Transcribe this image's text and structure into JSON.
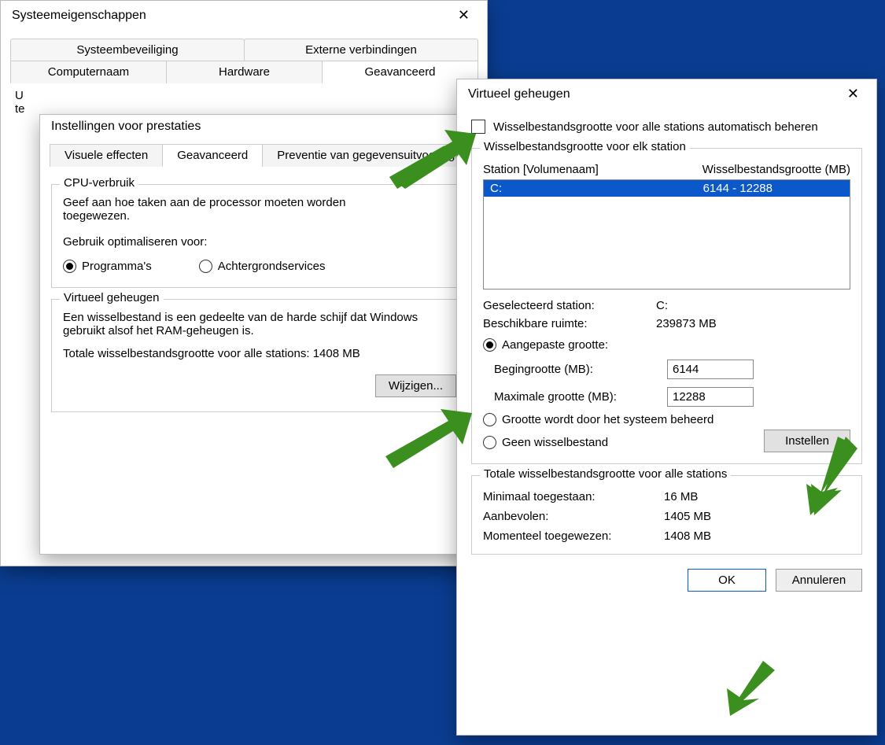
{
  "sys": {
    "title": "Systeemeigenschappen",
    "tabs_row1": [
      "Systeembeveiliging",
      "Externe verbindingen"
    ],
    "tabs_row2": [
      "Computernaam",
      "Hardware",
      "Geavanceerd"
    ],
    "active_tab": "Geavanceerd",
    "body_line1": "U",
    "body_line2": "te"
  },
  "perf": {
    "title": "Instellingen voor prestaties",
    "tabs": [
      "Visuele effecten",
      "Geavanceerd",
      "Preventie van gegevensuitvoering"
    ],
    "active_tab": "Geavanceerd",
    "cpu": {
      "group": "CPU-verbruik",
      "desc": "Geef aan hoe taken aan de processor moeten worden toegewezen.",
      "optimize": "Gebruik optimaliseren voor:",
      "opt_programs": "Programma's",
      "opt_bg": "Achtergrondservices"
    },
    "vm": {
      "group": "Virtueel geheugen",
      "desc": "Een wisselbestand is een gedeelte van de harde schijf dat Windows gebruikt alsof het RAM-geheugen is.",
      "total_label": "Totale wisselbestandsgrootte voor alle stations:",
      "total_value": "1408 MB",
      "change": "Wijzigen..."
    }
  },
  "vm": {
    "title": "Virtueel geheugen",
    "auto": "Wisselbestandsgrootte voor alle stations automatisch beheren",
    "per_station_group": "Wisselbestandsgrootte voor elk station",
    "col_station": "Station [Volumenaam]",
    "col_size": "Wisselbestandsgrootte (MB)",
    "row_drive": "C:",
    "row_size": "6144 - 12288",
    "selected_label": "Geselecteerd station:",
    "selected_value": "C:",
    "avail_label": "Beschikbare ruimte:",
    "avail_value": "239873 MB",
    "custom": "Aangepaste grootte:",
    "initial_label": "Begingrootte (MB):",
    "initial_value": "6144",
    "max_label": "Maximale grootte (MB):",
    "max_value": "12288",
    "sysmanaged": "Grootte wordt door het systeem beheerd",
    "none": "Geen wisselbestand",
    "set": "Instellen",
    "total_group": "Totale wisselbestandsgrootte voor alle stations",
    "min_label": "Minimaal toegestaan:",
    "min_value": "16 MB",
    "rec_label": "Aanbevolen:",
    "rec_value": "1405 MB",
    "cur_label": "Momenteel toegewezen:",
    "cur_value": "1408 MB",
    "ok": "OK",
    "cancel": "Annuleren"
  }
}
